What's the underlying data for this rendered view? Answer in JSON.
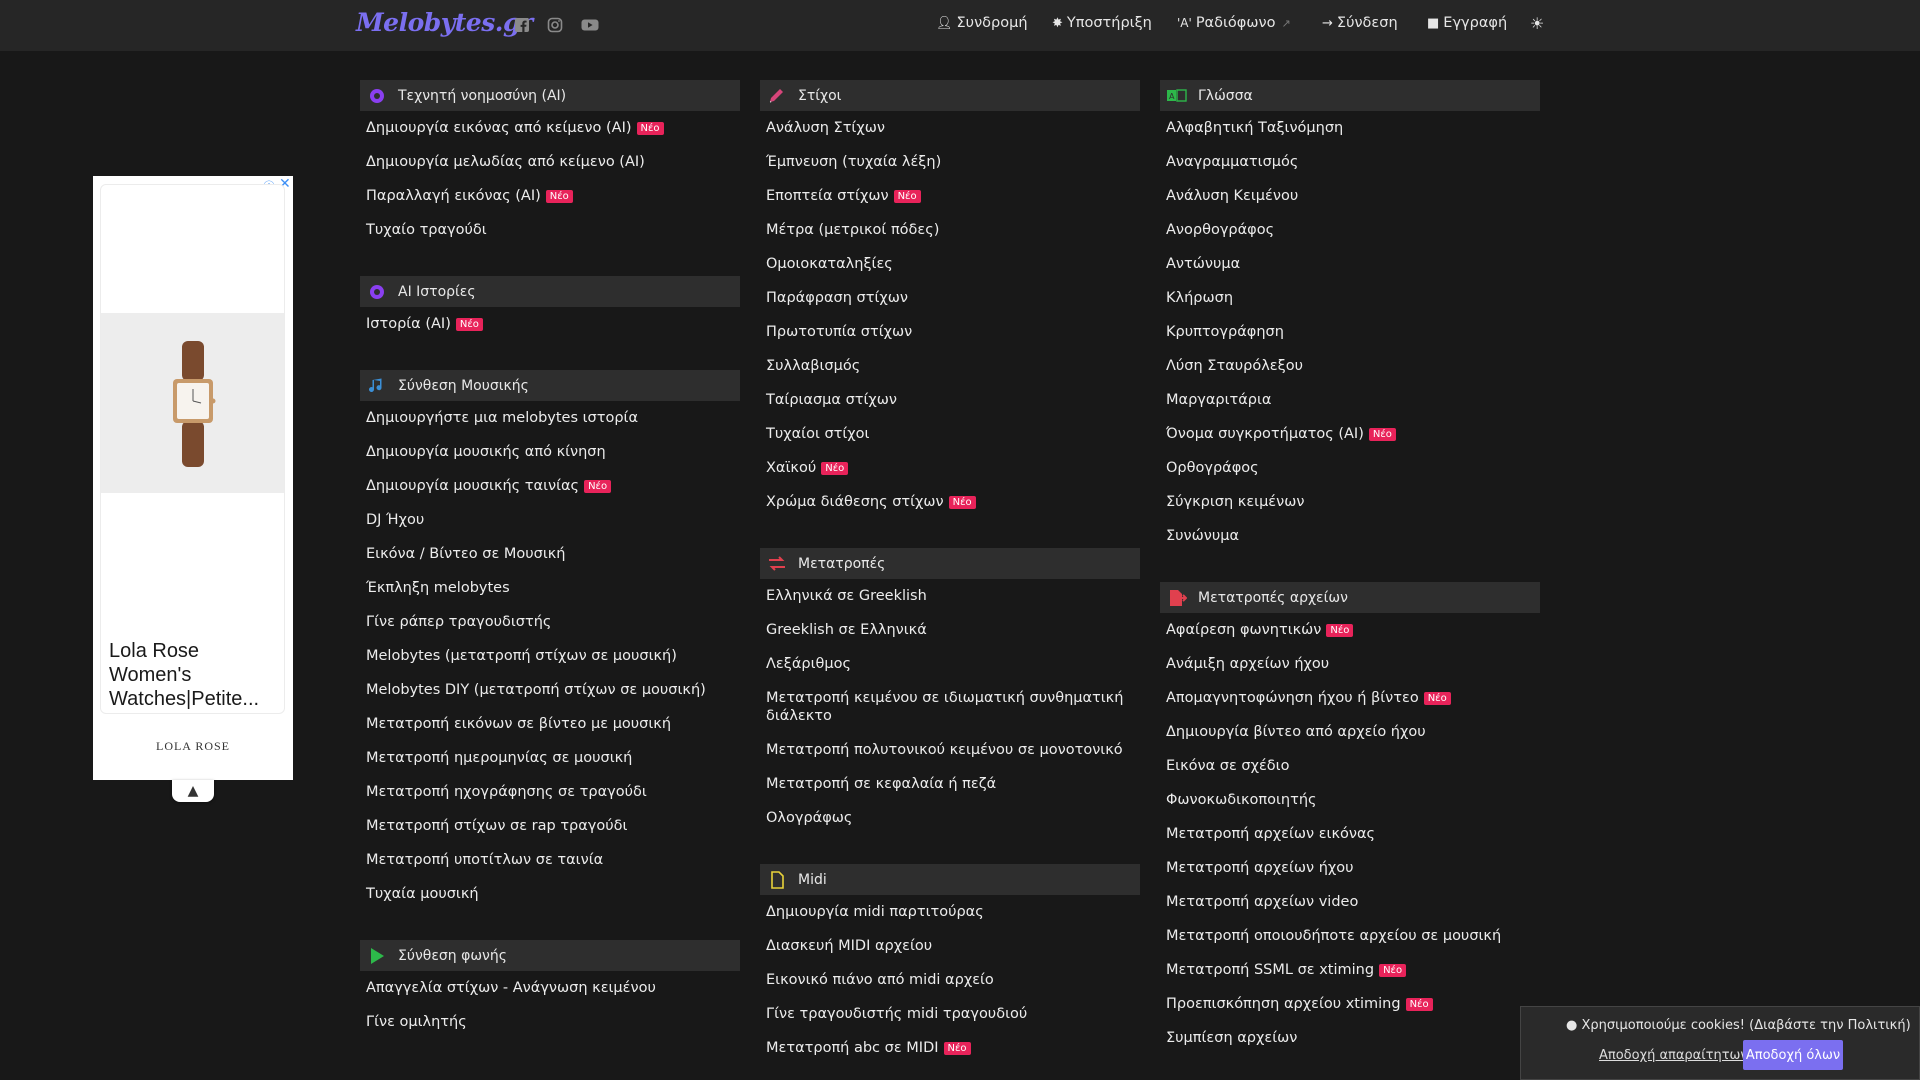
{
  "header": {
    "logo": "Melobytes.gr",
    "social": [
      "facebook-icon",
      "instagram-icon",
      "youtube-icon"
    ],
    "nav": [
      {
        "label": "Συνδρομή",
        "icon": "user-icon"
      },
      {
        "label": "Υποστήριξη",
        "icon": "lifebuoy-icon"
      },
      {
        "label": "Ραδιόφωνο",
        "icon": "radio-icon",
        "prefix": "'A'"
      },
      {
        "label": "Σύνδεση",
        "icon": "login-icon"
      },
      {
        "label": "Εγγραφή",
        "icon": "clipboard-icon"
      }
    ],
    "theme_icon": "sun-icon"
  },
  "badge_label": "Νέο",
  "columns": [
    {
      "sections": [
        {
          "title": "Τεχνητή νοημοσύνη (AI)",
          "icon": "ai-brain-icon",
          "icon_color": "#8a3ff0",
          "items": [
            {
              "label": "Δημιουργία εικόνας από κείμενο (AI)",
              "new": true
            },
            {
              "label": "Δημιουργία μελωδίας από κείμενο (AI)",
              "new": false
            },
            {
              "label": "Παραλλαγή εικόνας (AI)",
              "new": true
            },
            {
              "label": "Τυχαίο τραγούδι",
              "new": false
            }
          ]
        },
        {
          "title": "AI Ιστορίες",
          "icon": "ai-brain-icon",
          "icon_color": "#8a3ff0",
          "items": [
            {
              "label": "Ιστορία (AI)",
              "new": true
            }
          ]
        },
        {
          "title": "Σύνθεση Μουσικής",
          "icon": "music-note-icon",
          "icon_color": "#3b8fd6",
          "items": [
            {
              "label": "Δημιουργήστε μια melobytes ιστορία",
              "new": false
            },
            {
              "label": "Δημιουργία μουσικής από κίνηση",
              "new": false
            },
            {
              "label": "Δημιουργία μουσικής ταινίας",
              "new": true
            },
            {
              "label": "DJ Ήχου",
              "new": false
            },
            {
              "label": "Εικόνα / Βίντεο σε Μουσική",
              "new": false
            },
            {
              "label": "Έκπληξη melobytes",
              "new": false
            },
            {
              "label": "Γίνε ράπερ τραγουδιστής",
              "new": false
            },
            {
              "label": "Melobytes (μετατροπή στίχων σε μουσική)",
              "new": false
            },
            {
              "label": "Melobytes DIY (μετατροπή στίχων σε μουσική)",
              "new": false
            },
            {
              "label": "Μετατροπή εικόνων σε βίντεο με μουσική",
              "new": false
            },
            {
              "label": "Μετατροπή ημερομηνίας σε μουσική",
              "new": false
            },
            {
              "label": "Μετατροπή ηχογράφησης σε τραγούδι",
              "new": false
            },
            {
              "label": "Μετατροπή στίχων σε rap τραγούδι",
              "new": false
            },
            {
              "label": "Μετατροπή υποτίτλων σε ταινία",
              "new": false
            },
            {
              "label": "Τυχαία μουσική",
              "new": false
            }
          ]
        },
        {
          "title": "Σύνθεση φωνής",
          "icon": "play-icon",
          "icon_color": "#2db84a",
          "items": [
            {
              "label": "Απαγγελία στίχων - Ανάγνωση κειμένου",
              "new": false
            },
            {
              "label": "Γίνε ομιλητής",
              "new": false
            }
          ]
        }
      ]
    },
    {
      "sections": [
        {
          "title": "Στίχοι",
          "icon": "pencil-icon",
          "icon_color": "#d6457a",
          "items": [
            {
              "label": "Ανάλυση Στίχων",
              "new": false
            },
            {
              "label": "Έμπνευση (τυχαία λέξη)",
              "new": false
            },
            {
              "label": "Εποπτεία στίχων",
              "new": true
            },
            {
              "label": "Μέτρα (μετρικοί πόδες)",
              "new": false
            },
            {
              "label": "Ομοιοκαταληξίες",
              "new": false
            },
            {
              "label": "Παράφραση στίχων",
              "new": false
            },
            {
              "label": "Πρωτοτυπία στίχων",
              "new": false
            },
            {
              "label": "Συλλαβισμός",
              "new": false
            },
            {
              "label": "Ταίριασμα στίχων",
              "new": false
            },
            {
              "label": "Τυχαίοι στίχοι",
              "new": false
            },
            {
              "label": "Χαϊκού",
              "new": true
            },
            {
              "label": "Χρώμα διάθεσης στίχων",
              "new": true
            }
          ]
        },
        {
          "title": "Μετατροπές",
          "icon": "exchange-icon",
          "icon_color": "#e0404e",
          "items": [
            {
              "label": "Ελληνικά σε Greeklish",
              "new": false
            },
            {
              "label": "Greeklish σε Ελληνικά",
              "new": false
            },
            {
              "label": "Λεξάριθμος",
              "new": false
            },
            {
              "label": "Μετατροπή κειμένου σε ιδιωματική συνθηματική διάλεκτο",
              "new": false
            },
            {
              "label": "Μετατροπή πολυτονικού κειμένου σε μονοτονικό",
              "new": false
            },
            {
              "label": "Μετατροπή σε κεφαλαία ή πεζά",
              "new": false
            },
            {
              "label": "Ολογράφως",
              "new": false
            }
          ]
        },
        {
          "title": "Midi",
          "icon": "file-icon",
          "icon_color": "#e8d23a",
          "items": [
            {
              "label": "Δημιουργία midi παρτιτούρας",
              "new": false
            },
            {
              "label": "Διασκευή MIDI αρχείου",
              "new": false
            },
            {
              "label": "Εικονικό πιάνο από midi αρχείο",
              "new": false
            },
            {
              "label": "Γίνε τραγουδιστής midi τραγουδιού",
              "new": false
            },
            {
              "label": "Μετατροπή abc σε MIDI",
              "new": true
            }
          ]
        }
      ]
    },
    {
      "sections": [
        {
          "title": "Γλώσσα",
          "icon": "language-icon",
          "icon_color": "#2db84a",
          "items": [
            {
              "label": "Αλφαβητική Ταξινόμηση",
              "new": false
            },
            {
              "label": "Αναγραμματισμός",
              "new": false
            },
            {
              "label": "Ανάλυση Κειμένου",
              "new": false
            },
            {
              "label": "Ανορθογράφος",
              "new": false
            },
            {
              "label": "Αντώνυμα",
              "new": false
            },
            {
              "label": "Κλήρωση",
              "new": false
            },
            {
              "label": "Κρυπτογράφηση",
              "new": false
            },
            {
              "label": "Λύση Σταυρόλεξου",
              "new": false
            },
            {
              "label": "Μαργαριτάρια",
              "new": false
            },
            {
              "label": "Όνομα συγκροτήματος (AI)",
              "new": true
            },
            {
              "label": "Ορθογράφος",
              "new": false
            },
            {
              "label": "Σύγκριση κειμένων",
              "new": false
            },
            {
              "label": "Συνώνυμα",
              "new": false
            }
          ]
        },
        {
          "title": "Μετατροπές αρχείων",
          "icon": "file-export-icon",
          "icon_color": "#e0404e",
          "items": [
            {
              "label": "Αφαίρεση φωνητικών",
              "new": true
            },
            {
              "label": "Ανάμιξη αρχείων ήχου",
              "new": false
            },
            {
              "label": "Απομαγνητοφώνηση ήχου ή βίντεο",
              "new": true
            },
            {
              "label": "Δημιουργία βίντεο από αρχείο ήχου",
              "new": false
            },
            {
              "label": "Εικόνα σε σχέδιο",
              "new": false
            },
            {
              "label": "Φωνοκωδικοποιητής",
              "new": false
            },
            {
              "label": "Μετατροπή αρχείων εικόνας",
              "new": false
            },
            {
              "label": "Μετατροπή αρχείων ήχου",
              "new": false
            },
            {
              "label": "Μετατροπή αρχείων video",
              "new": false
            },
            {
              "label": "Μετατροπή οποιουδήποτε αρχείου σε μουσική",
              "new": false
            },
            {
              "label": "Μετατροπή SSML σε xtiming",
              "new": true
            },
            {
              "label": "Προεπισκόπηση αρχείου xtiming",
              "new": true
            },
            {
              "label": "Συμπίεση αρχείων",
              "new": false
            }
          ]
        }
      ]
    }
  ],
  "ad": {
    "title": "Lola Rose Women's Watches|Petite...",
    "brand": "LOLA ROSE"
  },
  "cookie": {
    "text": "Χρησιμοποιούμε cookies! (Διαβάστε την Πολιτική)",
    "necessary_label": "Αποδοχή απαραίτητων",
    "accept_all_label": "Αποδοχή όλων"
  }
}
